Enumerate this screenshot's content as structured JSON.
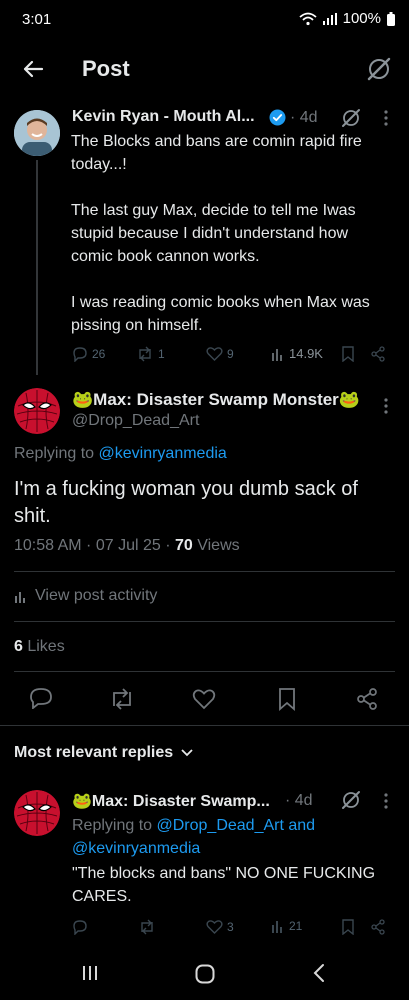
{
  "status_bar": {
    "time": "3:01",
    "battery": "100%"
  },
  "header": {
    "title": "Post"
  },
  "colors": {
    "accent": "#1d9bf0",
    "verified": "#1d9bf0",
    "muted": "#71767b"
  },
  "parent_post": {
    "name": "Kevin Ryan - Mouth Al...",
    "time": "· 4d",
    "paragraphs": [
      "The Blocks and bans are comin rapid fire today...!",
      "The last guy Max, decide to tell me Iwas stupid because I didn't understand how comic book cannon works.",
      "I was reading comic books when Max was pissing on himself."
    ],
    "replies": "26",
    "reposts": "1",
    "likes": "9",
    "views": "14.9K"
  },
  "main_post": {
    "name": "🐸Max: Disaster Swamp Monster🐸",
    "handle": "@Drop_Dead_Art",
    "replying_label": "Replying to",
    "replying_to": "@kevinryanmedia",
    "text": "I'm a fucking woman you dumb sack of shit.",
    "timestamp": "10:58 AM · 07 Jul 25 · ",
    "views_count": "70",
    "views_label": " Views",
    "activity_label": "View post activity",
    "likes_count": "6",
    "likes_label": " Likes"
  },
  "replies_section": {
    "sort_label": "Most relevant replies"
  },
  "reply": {
    "name": "🐸Max: Disaster Swamp...",
    "time": "· 4d",
    "replying_label": "Replying to",
    "replying_to_1": "@Drop_Dead_Art",
    "and_label": " and",
    "replying_to_2": "@kevinryanmedia",
    "text": "\"The blocks and bans\" NO ONE FUCKING CARES.",
    "likes": "3",
    "views": "21"
  }
}
